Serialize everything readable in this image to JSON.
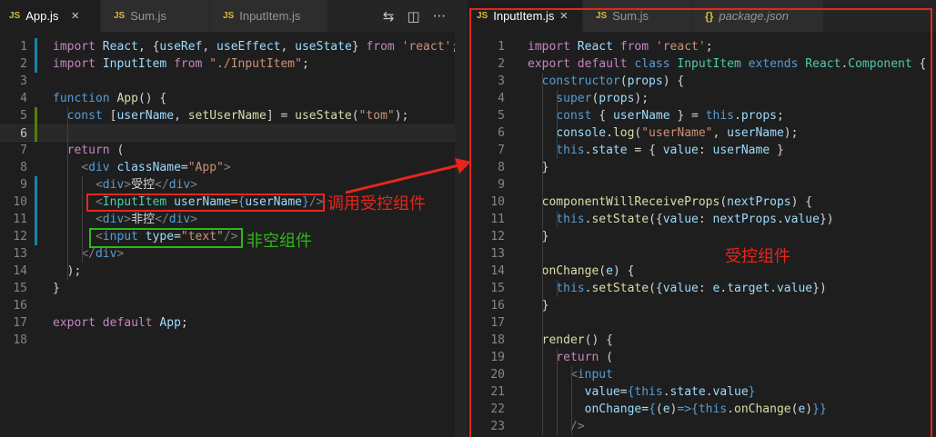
{
  "left_editor": {
    "tabs": [
      {
        "icon": "JS",
        "label": "App.js",
        "close": "×"
      },
      {
        "icon": "JS",
        "label": "Sum.js"
      },
      {
        "icon": "JS",
        "label": "InputItem.js"
      }
    ],
    "actions": {
      "compare": "⇆",
      "split": "◫",
      "more": "···"
    },
    "lines": [
      {
        "n": "1",
        "t": [
          [
            "import ",
            "c"
          ],
          [
            "React",
            "v"
          ],
          [
            ", {",
            "tx"
          ],
          [
            "useRef",
            "v"
          ],
          [
            ", ",
            "tx"
          ],
          [
            "useEffect",
            "v"
          ],
          [
            ", ",
            "tx"
          ],
          [
            "useState",
            "v"
          ],
          [
            "} ",
            "tx"
          ],
          [
            "from",
            "c"
          ],
          [
            " 'react'",
            "s"
          ],
          [
            ";",
            "tx"
          ]
        ]
      },
      {
        "n": "2",
        "t": [
          [
            "import ",
            "c"
          ],
          [
            "InputItem",
            "v"
          ],
          [
            " from ",
            "c"
          ],
          [
            "\"./InputItem\"",
            "s"
          ],
          [
            ";",
            "tx"
          ]
        ]
      },
      {
        "n": "3",
        "t": []
      },
      {
        "n": "4",
        "t": [
          [
            "function ",
            "k"
          ],
          [
            "App",
            "f"
          ],
          [
            "() {",
            "tx"
          ]
        ]
      },
      {
        "n": "5",
        "t": [
          [
            "  const ",
            "k"
          ],
          [
            "[",
            "tx"
          ],
          [
            "userName",
            "v"
          ],
          [
            ", ",
            "tx"
          ],
          [
            "setUserName",
            "f"
          ],
          [
            "] = ",
            "tx"
          ],
          [
            "useState",
            "f"
          ],
          [
            "(",
            "tx"
          ],
          [
            "\"tom\"",
            "s"
          ],
          [
            ");",
            "tx"
          ]
        ]
      },
      {
        "n": "6",
        "t": []
      },
      {
        "n": "7",
        "t": [
          [
            "  return ",
            "c"
          ],
          [
            "(",
            "tx"
          ]
        ]
      },
      {
        "n": "8",
        "t": [
          [
            "    <",
            "p"
          ],
          [
            "div ",
            "k"
          ],
          [
            "className",
            "v"
          ],
          [
            "=",
            "tx"
          ],
          [
            "\"App\"",
            "s"
          ],
          [
            ">",
            "p"
          ]
        ]
      },
      {
        "n": "9",
        "t": [
          [
            "      <",
            "p"
          ],
          [
            "div",
            "k"
          ],
          [
            ">",
            "p"
          ],
          [
            "受控",
            "tx"
          ],
          [
            "</",
            "p"
          ],
          [
            "div",
            "k"
          ],
          [
            ">",
            "p"
          ]
        ]
      },
      {
        "n": "10",
        "t": [
          [
            "      <",
            "p"
          ],
          [
            "InputItem ",
            "t"
          ],
          [
            "userName",
            "v"
          ],
          [
            "=",
            "tx"
          ],
          [
            "{",
            "k"
          ],
          [
            "userName",
            "v"
          ],
          [
            "}",
            "k"
          ],
          [
            "/>",
            "p"
          ]
        ]
      },
      {
        "n": "11",
        "t": [
          [
            "      <",
            "p"
          ],
          [
            "div",
            "k"
          ],
          [
            ">",
            "p"
          ],
          [
            "非控",
            "tx"
          ],
          [
            "</",
            "p"
          ],
          [
            "div",
            "k"
          ],
          [
            ">",
            "p"
          ]
        ]
      },
      {
        "n": "12",
        "t": [
          [
            "      <",
            "p"
          ],
          [
            "input ",
            "k"
          ],
          [
            "type",
            "v"
          ],
          [
            "=",
            "tx"
          ],
          [
            "\"text\"",
            "s"
          ],
          [
            "/>",
            "p"
          ]
        ]
      },
      {
        "n": "13",
        "t": [
          [
            "    </",
            "p"
          ],
          [
            "div",
            "k"
          ],
          [
            ">",
            "p"
          ]
        ]
      },
      {
        "n": "14",
        "t": [
          [
            "  );",
            "tx"
          ]
        ]
      },
      {
        "n": "15",
        "t": [
          [
            "}",
            "tx"
          ]
        ]
      },
      {
        "n": "16",
        "t": []
      },
      {
        "n": "17",
        "t": [
          [
            "export ",
            "c"
          ],
          [
            "default ",
            "c"
          ],
          [
            "App",
            "v"
          ],
          [
            ";",
            "tx"
          ]
        ]
      },
      {
        "n": "18",
        "t": []
      }
    ],
    "annotations": {
      "controlled_call": "调用受控组件",
      "uncontrolled": "非空组件"
    }
  },
  "right_editor": {
    "tabs": [
      {
        "icon": "JS",
        "label": "InputItem.js",
        "close": "×"
      },
      {
        "icon": "JS",
        "label": "Sum.js"
      },
      {
        "icon": "{}",
        "label": "package.json"
      }
    ],
    "lines": [
      {
        "n": "1",
        "t": [
          [
            "import ",
            "c"
          ],
          [
            "React ",
            "v"
          ],
          [
            "from ",
            "c"
          ],
          [
            "'react'",
            "s"
          ],
          [
            ";",
            "tx"
          ]
        ]
      },
      {
        "n": "2",
        "t": [
          [
            "export ",
            "c"
          ],
          [
            "default ",
            "c"
          ],
          [
            "class ",
            "k"
          ],
          [
            "InputItem ",
            "t"
          ],
          [
            "extends ",
            "k"
          ],
          [
            "React",
            "t"
          ],
          [
            ".",
            "tx"
          ],
          [
            "Component ",
            "t"
          ],
          [
            "{",
            "tx"
          ]
        ]
      },
      {
        "n": "3",
        "t": [
          [
            "  constructor",
            "k"
          ],
          [
            "(",
            "tx"
          ],
          [
            "props",
            "v"
          ],
          [
            ") {",
            "tx"
          ]
        ]
      },
      {
        "n": "4",
        "t": [
          [
            "    super",
            "k"
          ],
          [
            "(",
            "tx"
          ],
          [
            "props",
            "v"
          ],
          [
            ");",
            "tx"
          ]
        ]
      },
      {
        "n": "5",
        "t": [
          [
            "    const ",
            "k"
          ],
          [
            "{ ",
            "tx"
          ],
          [
            "userName",
            "v"
          ],
          [
            " } = ",
            "tx"
          ],
          [
            "this",
            "k"
          ],
          [
            ".",
            "tx"
          ],
          [
            "props",
            "v"
          ],
          [
            ";",
            "tx"
          ]
        ]
      },
      {
        "n": "6",
        "t": [
          [
            "    console",
            "v"
          ],
          [
            ".",
            "tx"
          ],
          [
            "log",
            "f"
          ],
          [
            "(",
            "tx"
          ],
          [
            "\"userName\"",
            "s"
          ],
          [
            ", ",
            "tx"
          ],
          [
            "userName",
            "v"
          ],
          [
            ");",
            "tx"
          ]
        ]
      },
      {
        "n": "7",
        "t": [
          [
            "    this",
            "k"
          ],
          [
            ".",
            "tx"
          ],
          [
            "state",
            "v"
          ],
          [
            " = { ",
            "tx"
          ],
          [
            "value",
            "v"
          ],
          [
            ": ",
            "tx"
          ],
          [
            "userName",
            "v"
          ],
          [
            " }",
            "tx"
          ]
        ]
      },
      {
        "n": "8",
        "t": [
          [
            "  }",
            "tx"
          ]
        ]
      },
      {
        "n": "9",
        "t": []
      },
      {
        "n": "10",
        "t": [
          [
            "  componentWillReceiveProps",
            "f"
          ],
          [
            "(",
            "tx"
          ],
          [
            "nextProps",
            "v"
          ],
          [
            ") {",
            "tx"
          ]
        ]
      },
      {
        "n": "11",
        "t": [
          [
            "    this",
            "k"
          ],
          [
            ".",
            "tx"
          ],
          [
            "setState",
            "f"
          ],
          [
            "({",
            "tx"
          ],
          [
            "value",
            "v"
          ],
          [
            ": ",
            "tx"
          ],
          [
            "nextProps",
            "v"
          ],
          [
            ".",
            "tx"
          ],
          [
            "value",
            "v"
          ],
          [
            "})",
            "tx"
          ]
        ]
      },
      {
        "n": "12",
        "t": [
          [
            "  }",
            "tx"
          ]
        ]
      },
      {
        "n": "13",
        "t": []
      },
      {
        "n": "14",
        "t": [
          [
            "  onChange",
            "f"
          ],
          [
            "(",
            "tx"
          ],
          [
            "e",
            "v"
          ],
          [
            ") {",
            "tx"
          ]
        ]
      },
      {
        "n": "15",
        "t": [
          [
            "    this",
            "k"
          ],
          [
            ".",
            "tx"
          ],
          [
            "setState",
            "f"
          ],
          [
            "({",
            "tx"
          ],
          [
            "value",
            "v"
          ],
          [
            ": ",
            "tx"
          ],
          [
            "e",
            "v"
          ],
          [
            ".",
            "tx"
          ],
          [
            "target",
            "v"
          ],
          [
            ".",
            "tx"
          ],
          [
            "value",
            "v"
          ],
          [
            "})",
            "tx"
          ]
        ]
      },
      {
        "n": "16",
        "t": [
          [
            "  }",
            "tx"
          ]
        ]
      },
      {
        "n": "17",
        "t": []
      },
      {
        "n": "18",
        "t": [
          [
            "  render",
            "f"
          ],
          [
            "() {",
            "tx"
          ]
        ]
      },
      {
        "n": "19",
        "t": [
          [
            "    return ",
            "c"
          ],
          [
            "(",
            "tx"
          ]
        ]
      },
      {
        "n": "20",
        "t": [
          [
            "      <",
            "p"
          ],
          [
            "input",
            "k"
          ]
        ]
      },
      {
        "n": "21",
        "t": [
          [
            "        value",
            "v"
          ],
          [
            "=",
            "tx"
          ],
          [
            "{",
            "k"
          ],
          [
            "this",
            "k"
          ],
          [
            ".",
            "tx"
          ],
          [
            "state",
            "v"
          ],
          [
            ".",
            "tx"
          ],
          [
            "value",
            "v"
          ],
          [
            "}",
            "k"
          ]
        ]
      },
      {
        "n": "22",
        "t": [
          [
            "        onChange",
            "v"
          ],
          [
            "=",
            "tx"
          ],
          [
            "{",
            "k"
          ],
          [
            "(",
            "tx"
          ],
          [
            "e",
            "v"
          ],
          [
            ")",
            "tx"
          ],
          [
            "=>",
            "k"
          ],
          [
            "{",
            "k"
          ],
          [
            "this",
            "k"
          ],
          [
            ".",
            "tx"
          ],
          [
            "onChange",
            "f"
          ],
          [
            "(",
            "tx"
          ],
          [
            "e",
            "v"
          ],
          [
            ")",
            "tx"
          ],
          [
            "}",
            "k"
          ],
          [
            "}",
            "k"
          ]
        ]
      },
      {
        "n": "23",
        "t": [
          [
            "      />",
            "p"
          ]
        ]
      }
    ],
    "annotations": {
      "controlled": "受控组件"
    }
  },
  "colors": {
    "red": "#e8251c",
    "green": "#31b51d",
    "blue_mark": "#1b81a8",
    "green_mark": "#587c0c"
  }
}
